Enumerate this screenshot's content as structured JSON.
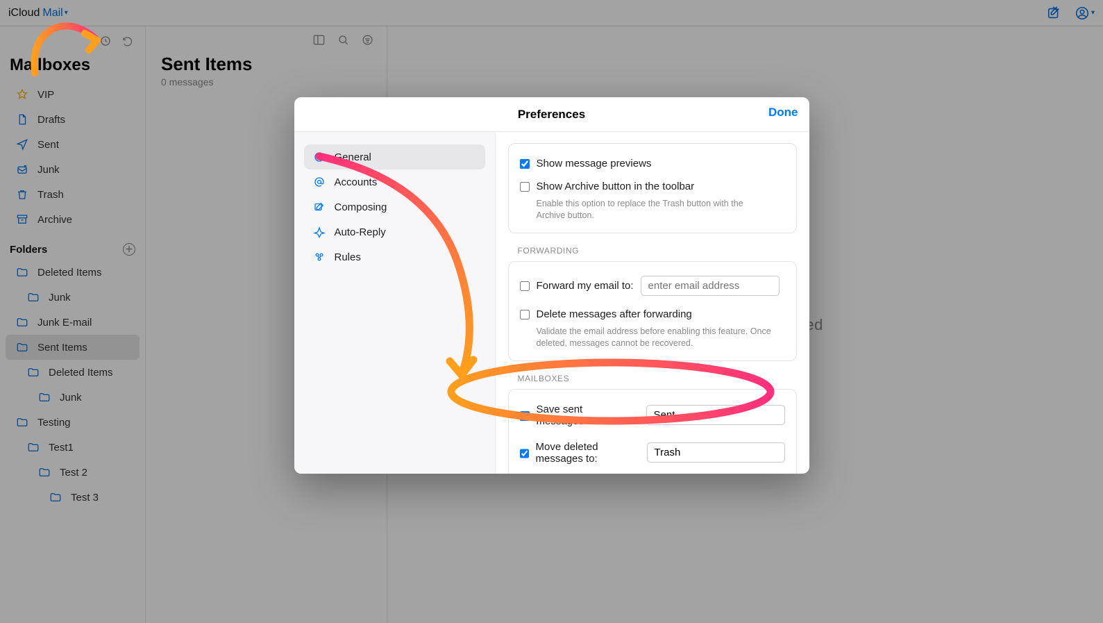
{
  "brand": {
    "icloud": "iCloud",
    "mail": "Mail"
  },
  "sidebar": {
    "title": "Mailboxes",
    "items": [
      {
        "label": "VIP"
      },
      {
        "label": "Drafts"
      },
      {
        "label": "Sent"
      },
      {
        "label": "Junk"
      },
      {
        "label": "Trash"
      },
      {
        "label": "Archive"
      }
    ],
    "folders_title": "Folders",
    "folders": [
      {
        "label": "Deleted Items",
        "indent": 0
      },
      {
        "label": "Junk",
        "indent": 1
      },
      {
        "label": "Junk E-mail",
        "indent": 0
      },
      {
        "label": "Sent Items",
        "indent": 0,
        "selected": true
      },
      {
        "label": "Deleted Items",
        "indent": 1
      },
      {
        "label": "Junk",
        "indent": 2
      },
      {
        "label": "Testing",
        "indent": 0
      },
      {
        "label": "Test1",
        "indent": 1
      },
      {
        "label": "Test 2",
        "indent": 2
      },
      {
        "label": "Test 3",
        "indent": 3
      }
    ]
  },
  "mid": {
    "title": "Sent Items",
    "count": "0 messages"
  },
  "detail": {
    "empty": "No Message Selected"
  },
  "modal": {
    "title": "Preferences",
    "done": "Done",
    "nav": [
      {
        "label": "General"
      },
      {
        "label": "Accounts"
      },
      {
        "label": "Composing"
      },
      {
        "label": "Auto-Reply"
      },
      {
        "label": "Rules"
      }
    ],
    "general": {
      "show_previews": "Show message previews",
      "show_archive": "Show Archive button in the toolbar",
      "show_archive_hint": "Enable this option to replace the Trash button with the Archive button.",
      "forwarding_section": "FORWARDING",
      "forward_label": "Forward my email to:",
      "forward_placeholder": "enter email address",
      "delete_after_fwd": "Delete messages after forwarding",
      "delete_after_fwd_hint": "Validate the email address before enabling this feature. Once deleted, messages cannot be recovered.",
      "mailboxes_section": "MAILBOXES",
      "save_sent_label": "Save sent messages in:",
      "save_sent_value": "Sent",
      "move_deleted_label": "Move deleted messages to:",
      "move_deleted_value": "Trash"
    }
  },
  "annotations": {
    "arrow_color_start": "#ff2e7e",
    "arrow_color_end": "#ff9f1c"
  },
  "colors": {
    "accent": "#007aff",
    "link": "#0071e3"
  }
}
